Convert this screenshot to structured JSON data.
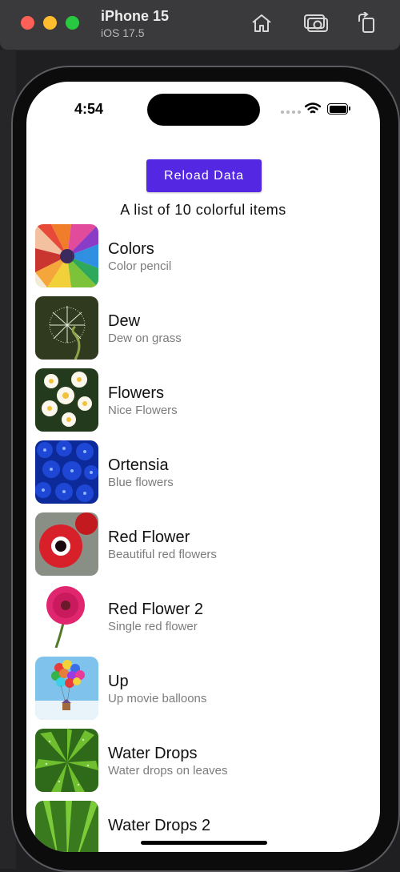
{
  "simulator": {
    "device": "iPhone 15",
    "os": "iOS 17.5",
    "toolbar_icons": [
      "home-icon",
      "screenshot-icon",
      "rotate-icon"
    ]
  },
  "status_bar": {
    "time": "4:54"
  },
  "app": {
    "reload_label": "Reload Data",
    "subtitle": "A list of 10 colorful items",
    "items": [
      {
        "title": "Colors",
        "subtitle": "Color pencil"
      },
      {
        "title": "Dew",
        "subtitle": "Dew on grass"
      },
      {
        "title": "Flowers",
        "subtitle": "Nice Flowers"
      },
      {
        "title": "Ortensia",
        "subtitle": "Blue flowers"
      },
      {
        "title": "Red Flower",
        "subtitle": "Beautiful red flowers"
      },
      {
        "title": "Red Flower 2",
        "subtitle": "Single red flower"
      },
      {
        "title": "Up",
        "subtitle": "Up movie balloons"
      },
      {
        "title": "Water Drops",
        "subtitle": "Water drops on leaves"
      },
      {
        "title": "Water Drops 2",
        "subtitle": ""
      }
    ]
  },
  "colors": {
    "accent": "#5428e2"
  }
}
